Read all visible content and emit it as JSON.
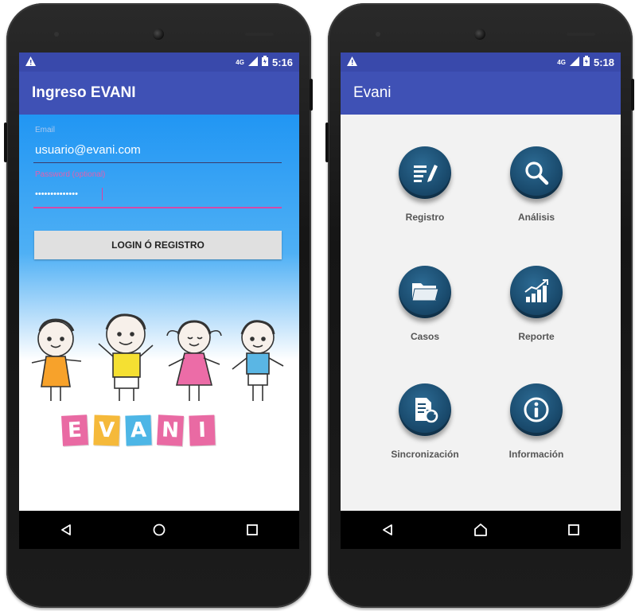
{
  "left_phone": {
    "status": {
      "warning_icon": "warning-icon",
      "network": "4G",
      "time": "5:16"
    },
    "appbar_title": "Ingreso EVANI",
    "form": {
      "email_label": "Email",
      "email_value": "usuario@evani.com",
      "password_label": "Password (optional)",
      "password_value": "••••••••••••••",
      "login_button": "LOGIN Ó REGISTRO"
    },
    "logo_letters": [
      "E",
      "V",
      "A",
      "N",
      "I"
    ],
    "logo_colors": [
      "#e96aa3",
      "#f5b93a",
      "#4db6e6",
      "#e96aa3",
      "#e96aa3"
    ],
    "nav": [
      "back-icon",
      "home-icon",
      "recents-icon"
    ]
  },
  "right_phone": {
    "status": {
      "warning_icon": "warning-icon",
      "network": "4G",
      "time": "5:18"
    },
    "appbar_title": "Evani",
    "menu": [
      {
        "label": "Registro",
        "icon": "edit-document-icon"
      },
      {
        "label": "Análisis",
        "icon": "magnifier-icon"
      },
      {
        "label": "Casos",
        "icon": "folder-icon"
      },
      {
        "label": "Reporte",
        "icon": "bar-chart-icon"
      },
      {
        "label": "Sincronización",
        "icon": "sync-document-icon"
      },
      {
        "label": "Información",
        "icon": "info-icon"
      }
    ],
    "nav": [
      "back-icon",
      "home-icon",
      "recents-icon"
    ]
  },
  "colors": {
    "primary": "#3f51b5",
    "primary_dark": "#3949ab",
    "accent": "#e040a0",
    "menu_button": "#1b4d70"
  }
}
